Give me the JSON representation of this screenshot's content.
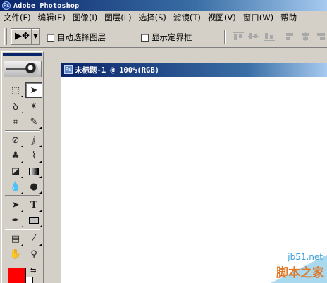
{
  "window": {
    "title": "Adobe Photoshop",
    "app_icon": "Ps"
  },
  "menu": [
    {
      "label": "文件(F)"
    },
    {
      "label": "编辑(E)"
    },
    {
      "label": "图像(I)"
    },
    {
      "label": "图层(L)"
    },
    {
      "label": "选择(S)"
    },
    {
      "label": "滤镜(T)"
    },
    {
      "label": "视图(V)"
    },
    {
      "label": "窗口(W)"
    },
    {
      "label": "帮助"
    }
  ],
  "options": {
    "tool_preset_icon": "move-tool-icon",
    "auto_select_layer": {
      "label": "自动选择图层",
      "checked": false
    },
    "show_bounding_box": {
      "label": "显示定界框",
      "checked": false
    }
  },
  "toolbox": {
    "foreground_color": "#ff0000",
    "background_color": "#ffffff"
  },
  "document": {
    "title": "未标题-1 @ 100%(RGB)"
  },
  "watermark": {
    "site": "jb51.net",
    "brand": "脚本之家"
  }
}
